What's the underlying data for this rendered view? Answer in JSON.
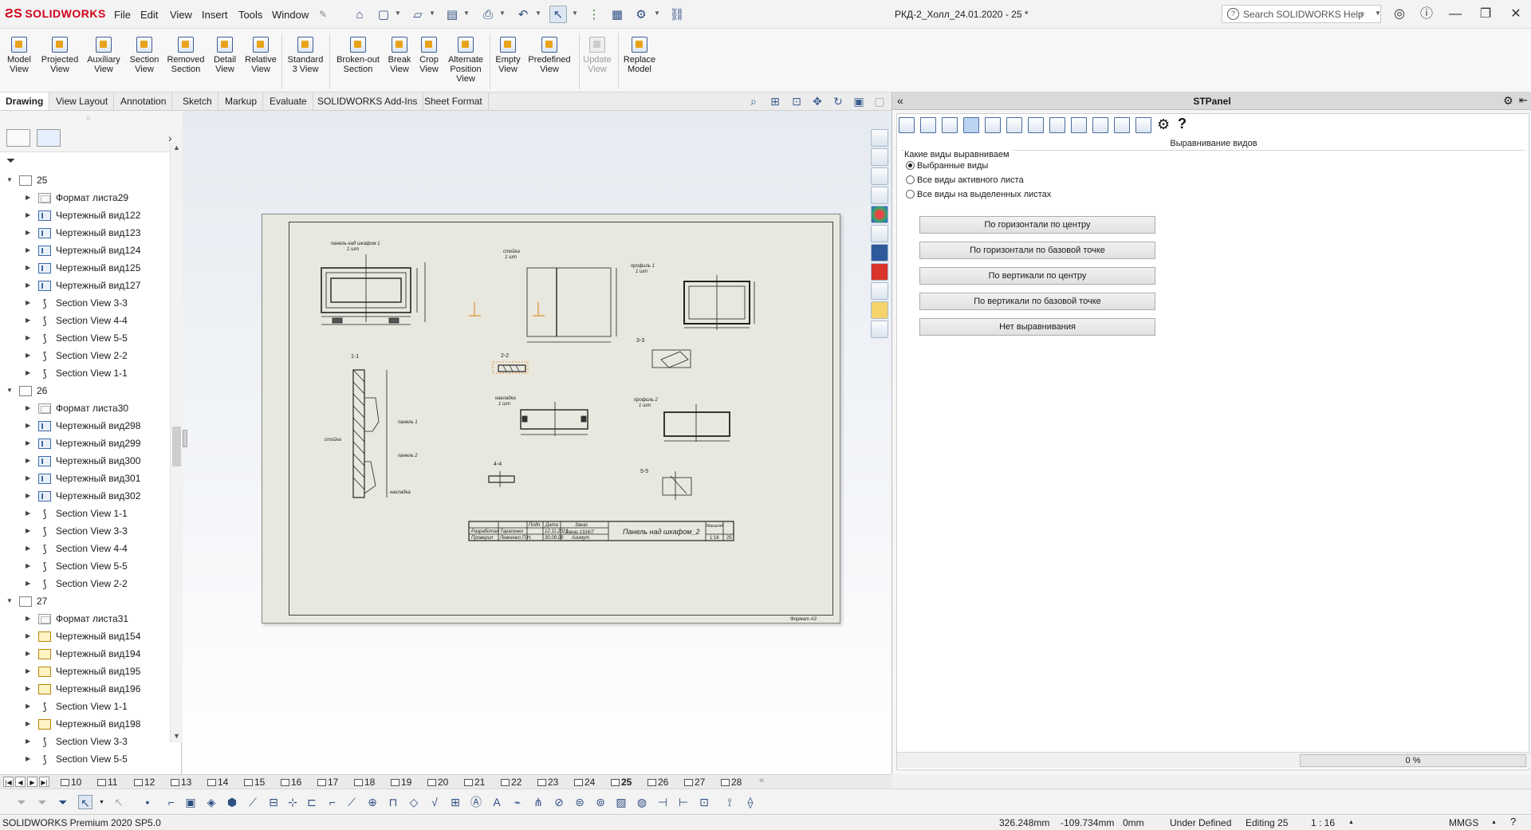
{
  "app": {
    "logo": "SOLIDWORKS",
    "document_title": "РКД-2_Холл_24.01.2020 - 25 *",
    "menu": [
      "File",
      "Edit",
      "View",
      "Insert",
      "Tools",
      "Window"
    ],
    "search_placeholder": "Search SOLIDWORKS Help"
  },
  "ribbon": {
    "buttons": [
      {
        "label": "Model\nView"
      },
      {
        "label": "Projected\nView"
      },
      {
        "label": "Auxiliary\nView"
      },
      {
        "label": "Section\nView"
      },
      {
        "label": "Removed\nSection"
      },
      {
        "label": "Detail\nView"
      },
      {
        "label": "Relative\nView"
      },
      {
        "label": "Standard\n3 View"
      },
      {
        "label": "Broken-out\nSection"
      },
      {
        "label": "Break\nView"
      },
      {
        "label": "Crop\nView"
      },
      {
        "label": "Alternate\nPosition\nView"
      },
      {
        "label": "Empty\nView"
      },
      {
        "label": "Predefined\nView"
      },
      {
        "label": "Update\nView"
      },
      {
        "label": "Replace\nModel"
      }
    ]
  },
  "tabs": [
    "Drawing",
    "View Layout",
    "Annotation",
    "Sketch",
    "Markup",
    "Evaluate",
    "SOLIDWORKS Add-Ins",
    "Sheet Format"
  ],
  "tree": [
    {
      "label": "25",
      "type": "sheet",
      "level": 0,
      "expanded": true
    },
    {
      "label": "Формат листа29",
      "type": "fmt",
      "level": 1
    },
    {
      "label": "Чертежный вид122",
      "type": "view",
      "level": 1
    },
    {
      "label": "Чертежный вид123",
      "type": "view",
      "level": 1
    },
    {
      "label": "Чертежный вид124",
      "type": "view",
      "level": 1
    },
    {
      "label": "Чертежный вид125",
      "type": "view",
      "level": 1
    },
    {
      "label": "Чертежный вид127",
      "type": "view",
      "level": 1
    },
    {
      "label": "Section View 3-3",
      "type": "sec",
      "level": 1
    },
    {
      "label": "Section View 4-4",
      "type": "sec",
      "level": 1
    },
    {
      "label": "Section View 5-5",
      "type": "sec",
      "level": 1
    },
    {
      "label": "Section View 2-2",
      "type": "sec",
      "level": 1
    },
    {
      "label": "Section View 1-1",
      "type": "sec",
      "level": 1
    },
    {
      "label": "26",
      "type": "sheet",
      "level": 0,
      "expanded": true
    },
    {
      "label": "Формат листа30",
      "type": "fmt",
      "level": 1
    },
    {
      "label": "Чертежный вид298",
      "type": "view",
      "level": 1
    },
    {
      "label": "Чертежный вид299",
      "type": "view",
      "level": 1
    },
    {
      "label": "Чертежный вид300",
      "type": "view",
      "level": 1
    },
    {
      "label": "Чертежный вид301",
      "type": "view",
      "level": 1
    },
    {
      "label": "Чертежный вид302",
      "type": "view",
      "level": 1
    },
    {
      "label": "Section View 1-1",
      "type": "sec",
      "level": 1
    },
    {
      "label": "Section View 3-3",
      "type": "sec",
      "level": 1
    },
    {
      "label": "Section View 4-4",
      "type": "sec",
      "level": 1
    },
    {
      "label": "Section View 5-5",
      "type": "sec",
      "level": 1
    },
    {
      "label": "Section View 2-2",
      "type": "sec",
      "level": 1
    },
    {
      "label": "27",
      "type": "sheet",
      "level": 0,
      "expanded": true
    },
    {
      "label": "Формат листа31",
      "type": "fmt",
      "level": 1
    },
    {
      "label": "Чертежный вид154",
      "type": "yel",
      "level": 1
    },
    {
      "label": "Чертежный вид194",
      "type": "yel",
      "level": 1
    },
    {
      "label": "Чертежный вид195",
      "type": "yel",
      "level": 1
    },
    {
      "label": "Чертежный вид196",
      "type": "yel",
      "level": 1
    },
    {
      "label": "Section View 1-1",
      "type": "sec",
      "level": 1
    },
    {
      "label": "Чертежный вид198",
      "type": "yel",
      "level": 1
    },
    {
      "label": "Section View 3-3",
      "type": "sec",
      "level": 1
    },
    {
      "label": "Section View 5-5",
      "type": "sec",
      "level": 1
    }
  ],
  "drawing": {
    "labels": {
      "v1_title": "панель над шкафом 1",
      "v1_qty": "1 шт",
      "v2_title": "стойка",
      "v2_qty": "1 шт",
      "v3_title": "профиль 1",
      "v3_qty": "1 шт",
      "s11": "1-1",
      "s22": "2-2",
      "s33": "3-3",
      "s44": "4-4",
      "s55": "5-5",
      "v4_title": "накладка",
      "v4_qty": "1 шт",
      "v5_title": "профиль 2",
      "v5_qty": "1 шт",
      "tb_name": "Панель над шкафом_2",
      "tb_developed": "Разработал",
      "tb_checked": "Проверил",
      "tb_dev_name": "Тарасенко",
      "tb_chk_name": "Левченко П.Н.",
      "tb_sign": "Подп.",
      "tb_date": "Дата",
      "tb_order": "Заказ",
      "tb_order_no": "Заказ 1316/7",
      "tb_client": "Азимут",
      "tb_date1": "12.11.2021",
      "tb_date2": "30.09.09",
      "tb_scale_label": "Масштаб",
      "tb_scale": "1:16",
      "tb_sheet": "25",
      "tb_format": "Формат А3",
      "panel1_note": "панель 1",
      "panel2_note": "панель 2",
      "stoika_note": "стойка",
      "nakladka_note": "накладка"
    }
  },
  "stpanel": {
    "title": "STPanel",
    "subtitle": "Выравнивание видов",
    "group_label": "Какие виды выравниваем",
    "radios": [
      {
        "label": "Выбранные виды",
        "checked": true
      },
      {
        "label": "Все виды активного листа",
        "checked": false
      },
      {
        "label": "Все виды на выделенных листах",
        "checked": false
      }
    ],
    "buttons": [
      "По горизонтали по центру",
      "По горизонтали по базовой точке",
      "По вертикали по центру",
      "По вертикали по базовой точке",
      "Нет выравнивания"
    ],
    "progress": "0 %"
  },
  "sheet_tabs": {
    "tabs": [
      "10",
      "11",
      "12",
      "13",
      "14",
      "15",
      "16",
      "17",
      "18",
      "19",
      "20",
      "21",
      "22",
      "23",
      "24",
      "25",
      "26",
      "27",
      "28"
    ],
    "active": "25"
  },
  "status": {
    "product": "SOLIDWORKS Premium 2020 SP5.0",
    "x": "326.248mm",
    "y": "-109.734mm",
    "z": "0mm",
    "state": "Under Defined",
    "editing": "Editing 25",
    "scale": "1 : 16",
    "units": "MMGS"
  }
}
